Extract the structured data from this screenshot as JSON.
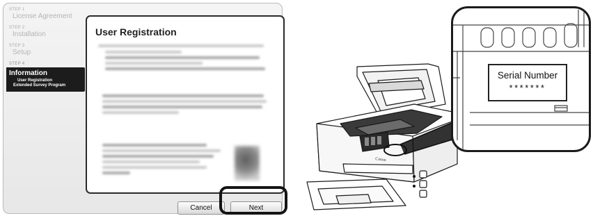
{
  "installer": {
    "steps": [
      {
        "number": "STEP 1",
        "name": "License Agreement"
      },
      {
        "number": "STEP 2",
        "name": "Installation"
      },
      {
        "number": "STEP 3",
        "name": "Setup"
      },
      {
        "number": "STEP 4",
        "name": "Information",
        "sub_items": [
          "User Registration",
          "Extended Survey Program"
        ]
      }
    ],
    "panel_title": "User Registration",
    "cancel_label": "Cancel",
    "next_label": "Next"
  },
  "printer": {
    "serial_label": "Serial Number",
    "serial_value": "*******",
    "brand": "Canon"
  }
}
